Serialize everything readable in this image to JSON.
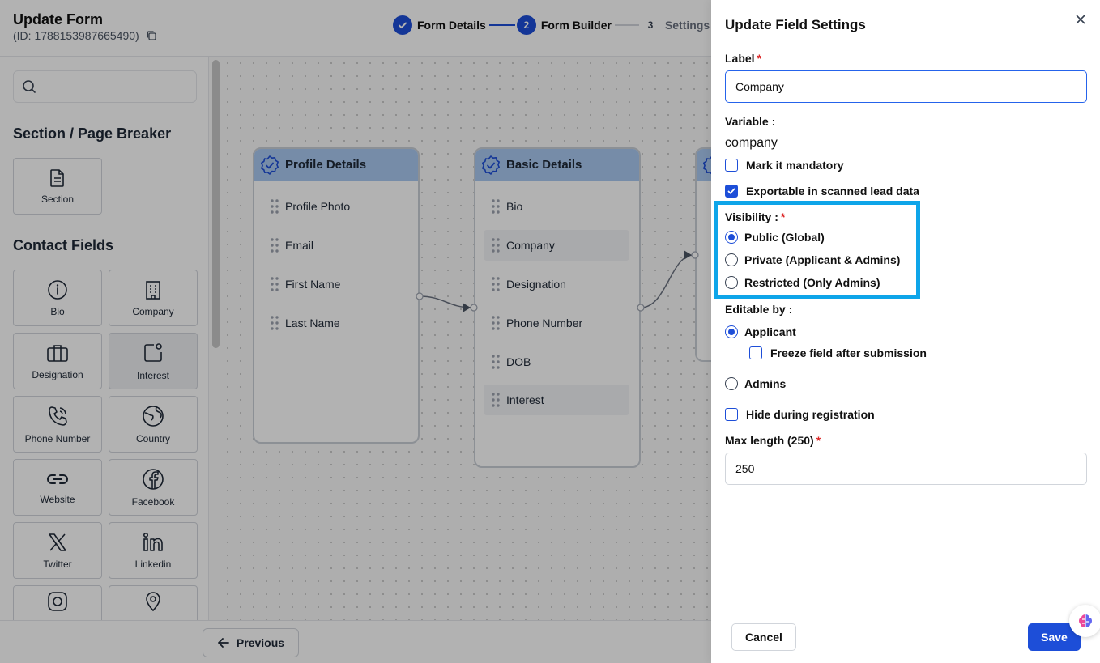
{
  "header": {
    "title": "Update Form",
    "form_id": "(ID: 1788153987665490)",
    "steps": [
      {
        "num": "1",
        "label": "Form Details",
        "state": "done"
      },
      {
        "num": "2",
        "label": "Form Builder",
        "state": "active"
      },
      {
        "num": "3",
        "label": "Settings",
        "state": "pending"
      }
    ]
  },
  "sidebar": {
    "search_placeholder": "",
    "section_heading": "Section / Page Breaker",
    "section_items": [
      {
        "label": "Section",
        "icon": "document-icon"
      }
    ],
    "contact_heading": "Contact Fields",
    "contact_items": [
      {
        "label": "Bio",
        "icon": "info-icon"
      },
      {
        "label": "Company",
        "icon": "building-icon"
      },
      {
        "label": "Designation",
        "icon": "briefcase-icon"
      },
      {
        "label": "Interest",
        "icon": "interest-icon"
      },
      {
        "label": "Phone Number",
        "icon": "phone-icon"
      },
      {
        "label": "Country",
        "icon": "globe-icon"
      },
      {
        "label": "Website",
        "icon": "link-icon"
      },
      {
        "label": "Facebook",
        "icon": "facebook-icon"
      },
      {
        "label": "Twitter",
        "icon": "x-icon"
      },
      {
        "label": "Linkedin",
        "icon": "linkedin-icon"
      }
    ]
  },
  "canvas": {
    "cards": [
      {
        "title": "Profile Details",
        "fields": [
          "Profile Photo",
          "Email",
          "First Name",
          "Last Name"
        ]
      },
      {
        "title": "Basic Details",
        "fields": [
          "Bio",
          "Company",
          "Designation",
          "Phone Number",
          "DOB",
          "Interest"
        ]
      }
    ]
  },
  "footer": {
    "previous_label": "Previous"
  },
  "drawer": {
    "title": "Update Field Settings",
    "label_label": "Label",
    "label_value": "Company",
    "variable_label": "Variable :",
    "variable_value": "company",
    "mark_mandatory": {
      "label": "Mark it mandatory",
      "checked": false
    },
    "exportable": {
      "label": "Exportable in scanned lead data",
      "checked": true
    },
    "visibility_label": "Visibility :",
    "visibility_options": [
      {
        "label": "Public (Global)",
        "selected": true
      },
      {
        "label": "Private (Applicant & Admins)",
        "selected": false
      },
      {
        "label": "Restricted (Only Admins)",
        "selected": false
      }
    ],
    "editable_label": "Editable by :",
    "editable_options": [
      {
        "label": "Applicant",
        "selected": true
      },
      {
        "label": "Admins",
        "selected": false
      }
    ],
    "freeze_field": {
      "label": "Freeze field after submission",
      "checked": false
    },
    "hide_registration": {
      "label": "Hide during registration",
      "checked": false
    },
    "max_length_label": "Max length (250)",
    "max_length_value": "250",
    "cancel_label": "Cancel",
    "save_label": "Save",
    "required_mark": "*"
  },
  "colors": {
    "primary": "#1d4ed8",
    "highlight": "#0ea5e9",
    "card_header": "#a9c9f1",
    "required": "#dc2626"
  }
}
